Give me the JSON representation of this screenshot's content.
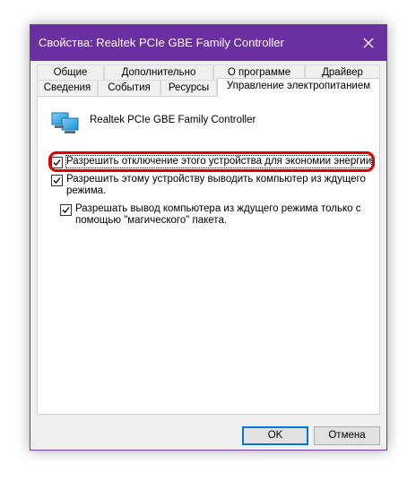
{
  "window": {
    "title": "Свойства: Realtek PCIe GBE Family Controller"
  },
  "tabs": {
    "row1": [
      "Общие",
      "Дополнительно",
      "О программе",
      "Драйвер"
    ],
    "row2": [
      "Сведения",
      "События",
      "Ресурсы",
      "Управление электропитанием"
    ],
    "active": "Управление электропитанием"
  },
  "device": {
    "icon": "network-adapter-icon",
    "name": "Realtek PCIe GBE Family Controller"
  },
  "options": [
    {
      "label": "Разрешить отключение этого устройства для экономии энергии",
      "checked": true
    },
    {
      "label_line1": "Разрешить этому устройству выводить компьютер из ждущего",
      "label_line2": "режима.",
      "checked": true
    },
    {
      "label_line1": "Разрешать вывод компьютера из ждущего режима только с",
      "label_line2": "помощью \"магического\" пакета.",
      "checked": true
    }
  ],
  "buttons": {
    "ok": "OK",
    "cancel": "Отмена"
  },
  "colors": {
    "titlebar": "#6a2fa0",
    "highlight": "#e00000",
    "default_button_border": "#0078d7"
  }
}
